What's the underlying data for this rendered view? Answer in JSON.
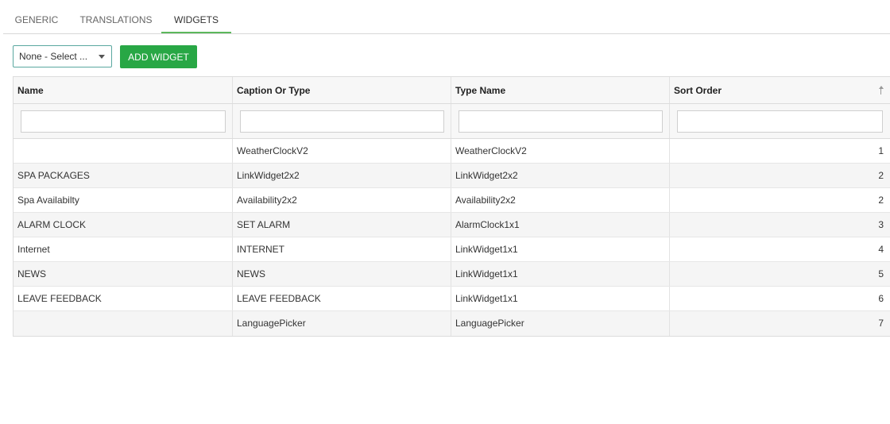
{
  "tabs": [
    {
      "label": "GENERIC"
    },
    {
      "label": "TRANSLATIONS"
    },
    {
      "label": "WIDGETS",
      "active": true
    }
  ],
  "toolbar": {
    "select_value": "None - Select ...",
    "add_button": "ADD WIDGET"
  },
  "grid": {
    "columns": [
      "Name",
      "Caption Or Type",
      "Type Name",
      "Sort Order"
    ],
    "rows": [
      {
        "name": "",
        "caption": "WeatherClockV2",
        "type_name": "WeatherClockV2",
        "sort": "1"
      },
      {
        "name": "SPA PACKAGES",
        "caption": "LinkWidget2x2",
        "type_name": "LinkWidget2x2",
        "sort": "2"
      },
      {
        "name": "Spa Availabilty",
        "caption": "Availability2x2",
        "type_name": "Availability2x2",
        "sort": "2"
      },
      {
        "name": "ALARM CLOCK",
        "caption": "SET ALARM",
        "type_name": "AlarmClock1x1",
        "sort": "3"
      },
      {
        "name": "Internet",
        "caption": "INTERNET",
        "type_name": "LinkWidget1x1",
        "sort": "4"
      },
      {
        "name": "NEWS",
        "caption": "NEWS",
        "type_name": "LinkWidget1x1",
        "sort": "5"
      },
      {
        "name": "LEAVE FEEDBACK",
        "caption": "LEAVE FEEDBACK",
        "type_name": "LinkWidget1x1",
        "sort": "6"
      },
      {
        "name": "",
        "caption": "LanguagePicker",
        "type_name": "LanguagePicker",
        "sort": "7"
      }
    ]
  },
  "colors": {
    "accent": "#28a745",
    "active_tab_underline": "#5cb85c"
  },
  "icons": {
    "sort": "sort-ascending-icon",
    "dropdown": "chevron-down-icon"
  }
}
